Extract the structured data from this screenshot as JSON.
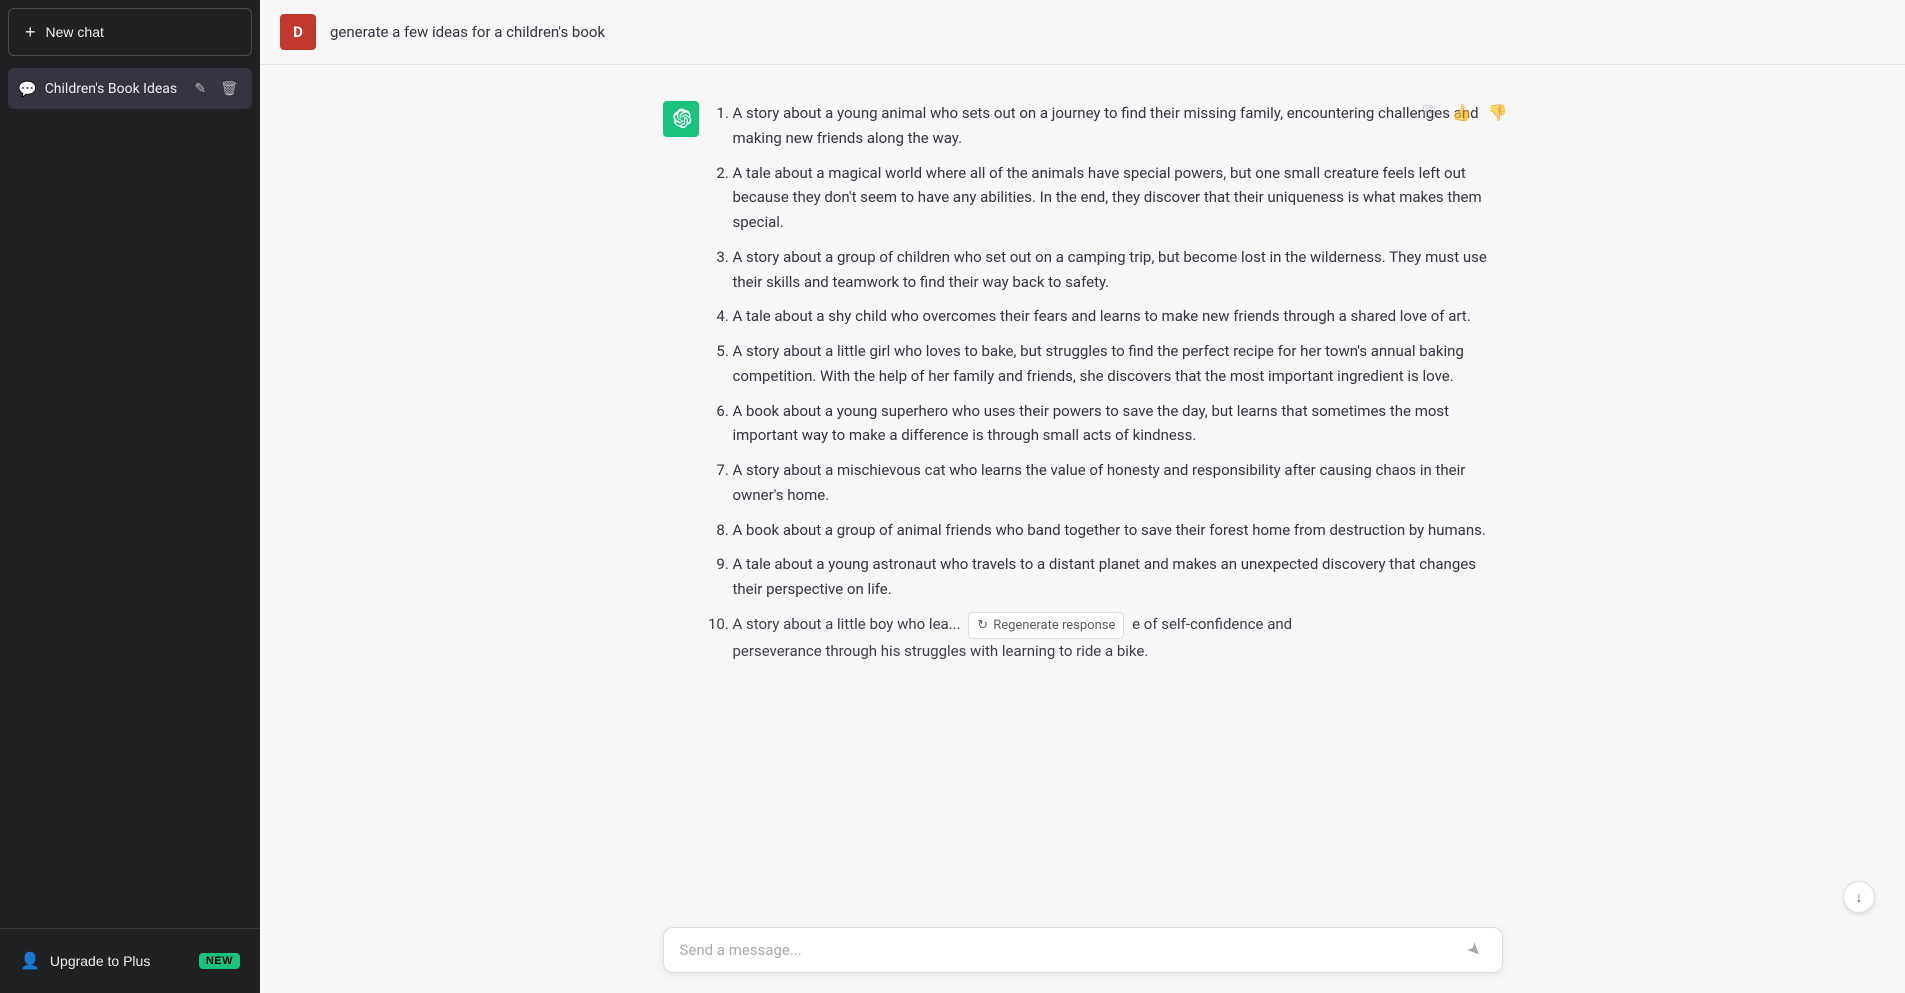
{
  "sidebar": {
    "new_chat_label": "New chat",
    "chat_items": [
      {
        "id": "childrens-book-ideas",
        "label": "Children's Book Ideas",
        "active": true
      }
    ],
    "upgrade_label": "Upgrade to Plus",
    "new_badge": "NEW"
  },
  "header": {
    "user_avatar_letter": "D",
    "user_message": "generate a few ideas for a children's book"
  },
  "response": {
    "items": [
      {
        "num": "1",
        "text": "A story about a young animal who sets out on a journey to find their missing family, encountering challenges and making new friends along the way."
      },
      {
        "num": "2",
        "text": "A tale about a magical world where all of the animals have special powers, but one small creature feels left out because they don't seem to have any abilities. In the end, they discover that their uniqueness is what makes them special."
      },
      {
        "num": "3",
        "text": "A story about a group of children who set out on a camping trip, but become lost in the wilderness. They must use their skills and teamwork to find their way back to safety."
      },
      {
        "num": "4",
        "text": "A tale about a shy child who overcomes their fears and learns to make new friends through a shared love of art."
      },
      {
        "num": "5",
        "text": "A story about a little girl who loves to bake, but struggles to find the perfect recipe for her town's annual baking competition. With the help of her family and friends, she discovers that the most important ingredient is love."
      },
      {
        "num": "6",
        "text": "A book about a young superhero who uses their powers to save the day, but learns that sometimes the most important way to make a difference is through small acts of kindness."
      },
      {
        "num": "7",
        "text": "A story about a mischievous cat who learns the value of honesty and responsibility after causing chaos in their owner's home."
      },
      {
        "num": "8",
        "text": "A book about a group of animal friends who band together to save their forest home from destruction by humans."
      },
      {
        "num": "9",
        "text": "A tale about a young astronaut who travels to a distant planet and makes an unexpected discovery that changes their perspective on life."
      },
      {
        "num": "10",
        "text": "A story about a little boy who lea... e of self-confidence and perseverance through his struggles with learning to ride a bike."
      }
    ],
    "regenerate_label": "Regenerate response",
    "copy_icon": "⎘",
    "thumbup_icon": "👍",
    "thumbdown_icon": "👎"
  },
  "input": {
    "placeholder": "Send a message...",
    "send_icon": "➤"
  },
  "icons": {
    "plus": "+",
    "chat_bubble": "💬",
    "edit": "✎",
    "trash": "🗑",
    "user": "👤",
    "scroll_down": "↓",
    "regenerate": "↻"
  }
}
